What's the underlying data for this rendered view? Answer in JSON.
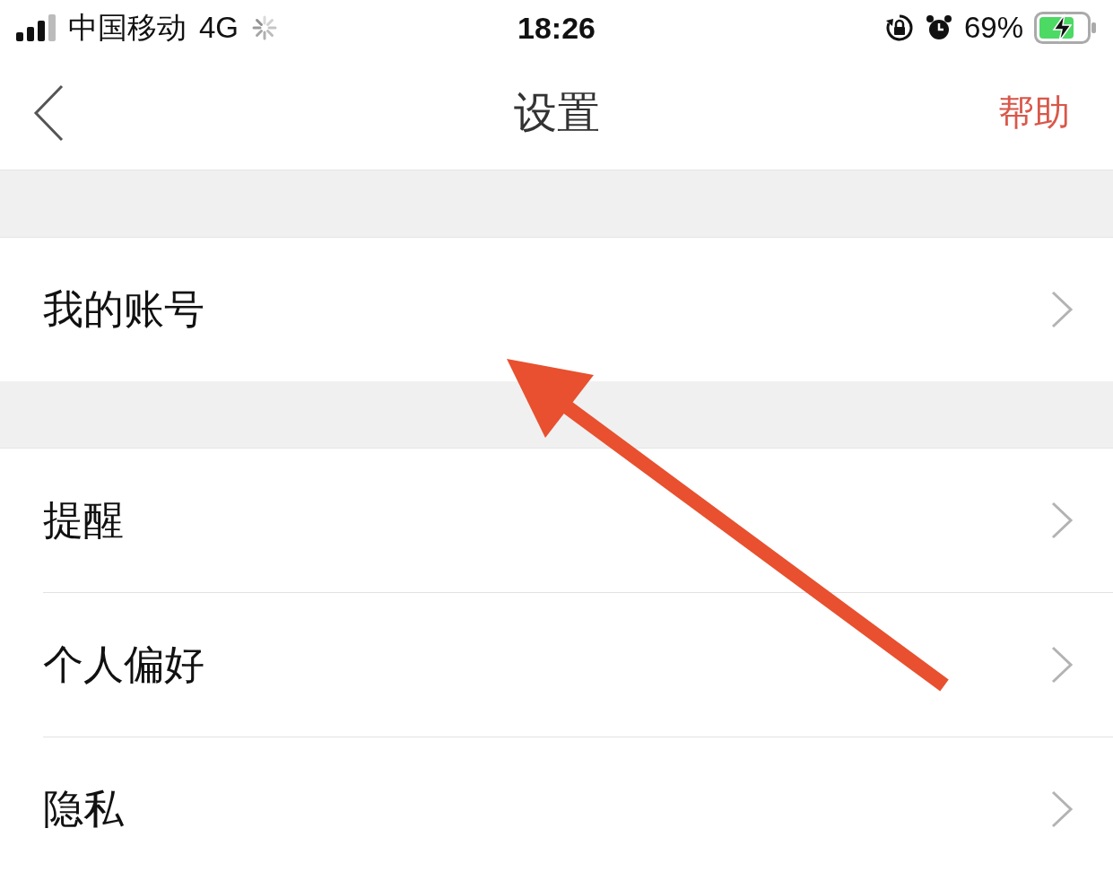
{
  "status_bar": {
    "carrier": "中国移动",
    "network": "4G",
    "time": "18:26",
    "battery": "69%"
  },
  "nav": {
    "title": "设置",
    "action": "帮助"
  },
  "sections": [
    {
      "items": [
        {
          "label": "我的账号"
        }
      ]
    },
    {
      "items": [
        {
          "label": "提醒"
        },
        {
          "label": "个人偏好"
        },
        {
          "label": "隐私"
        }
      ]
    }
  ],
  "annotation": {
    "kind": "arrow"
  }
}
